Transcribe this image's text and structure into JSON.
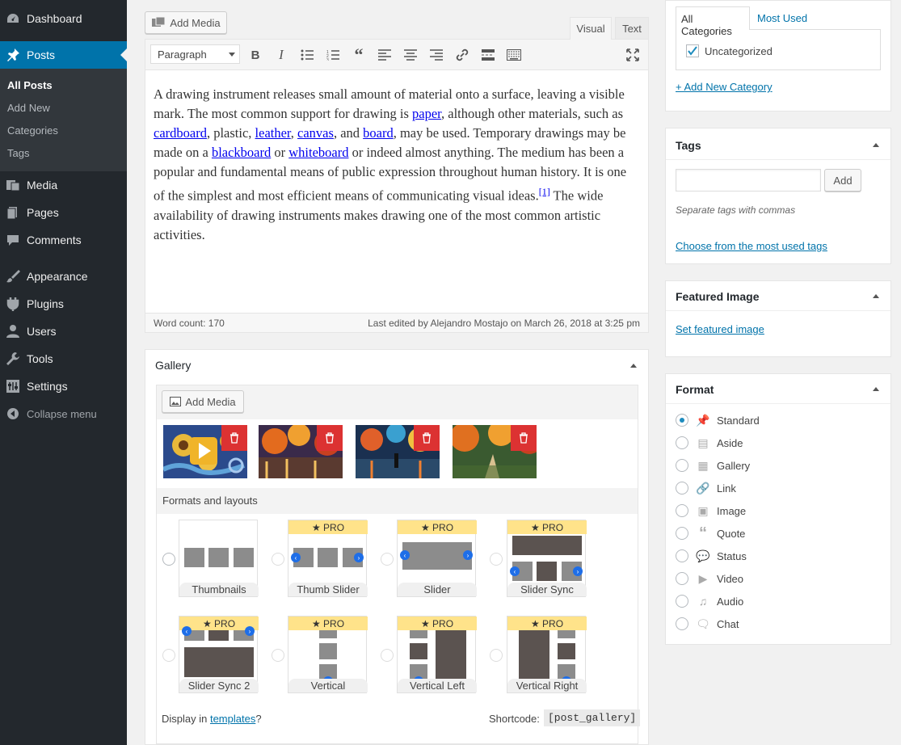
{
  "sidebar": {
    "items": [
      {
        "label": "Dashboard",
        "icon": "dashboard-icon"
      },
      {
        "label": "Posts",
        "icon": "pin-icon",
        "active": true
      },
      {
        "label": "Media",
        "icon": "media-icon"
      },
      {
        "label": "Pages",
        "icon": "pages-icon"
      },
      {
        "label": "Comments",
        "icon": "comments-icon"
      },
      {
        "label": "Appearance",
        "icon": "brush-icon"
      },
      {
        "label": "Plugins",
        "icon": "plugin-icon"
      },
      {
        "label": "Users",
        "icon": "user-icon"
      },
      {
        "label": "Tools",
        "icon": "wrench-icon"
      },
      {
        "label": "Settings",
        "icon": "settings-icon"
      },
      {
        "label": "Collapse menu",
        "icon": "collapse-icon"
      }
    ],
    "submenu": [
      "All Posts",
      "Add New",
      "Categories",
      "Tags"
    ]
  },
  "editor": {
    "add_media": "Add Media",
    "tab_visual": "Visual",
    "tab_text": "Text",
    "format_select": "Paragraph",
    "p1": "A drawing instrument releases small amount of material onto a surface, leaving a visible mark. The most common support for drawing is ",
    "l_paper": "paper",
    "t2": ", although other materials, such as ",
    "l_cardboard": "cardboard",
    "t3": ", plastic, ",
    "l_leather": "leather",
    "t4": ", ",
    "l_canvas": "canvas",
    "t5": ", and ",
    "l_board": "board",
    "t6": ", may be used. Temporary drawings may be made on a ",
    "l_blackboard": "blackboard",
    "t7": " or ",
    "l_whiteboard": "whiteboard",
    "t8": " or indeed almost anything. The medium has been a popular and fundamental means of public expression throughout human history. It is one of the simplest and most efficient means of communicating visual ideas.",
    "ref": "[1]",
    "t9": " The wide availability of drawing instruments makes drawing one of the most common artistic activities.",
    "word_count": "Word count: 170",
    "last_edited": "Last edited by Alejandro Mostajo on March 26, 2018 at 3:25 pm"
  },
  "gallery": {
    "title": "Gallery",
    "add_media": "Add Media",
    "formats_title": "Formats and layouts",
    "pro": "PRO",
    "layouts": [
      "Thumbnails",
      "Thumb Slider",
      "Slider",
      "Slider Sync",
      "Slider Sync 2",
      "Vertical",
      "Vertical Left",
      "Vertical Right"
    ],
    "display_in": "Display in ",
    "templates_link": "templates",
    "qmark": "?",
    "shortcode_label": "Shortcode:",
    "shortcode": "[post_gallery]"
  },
  "categories": {
    "tab_all": "All Categories",
    "tab_most": "Most Used",
    "item": "Uncategorized",
    "add_new": "+ Add New Category"
  },
  "tags": {
    "title": "Tags",
    "add": "Add",
    "hint": "Separate tags with commas",
    "choose": "Choose from the most used tags"
  },
  "featured": {
    "title": "Featured Image",
    "set": "Set featured image"
  },
  "format": {
    "title": "Format",
    "options": [
      "Standard",
      "Aside",
      "Gallery",
      "Link",
      "Image",
      "Quote",
      "Status",
      "Video",
      "Audio",
      "Chat"
    ],
    "selected": "Standard"
  },
  "colors": {
    "sidebar": "#23282d",
    "accent": "#0073aa",
    "delete": "#dc3232",
    "pro": "#ffe38a"
  }
}
